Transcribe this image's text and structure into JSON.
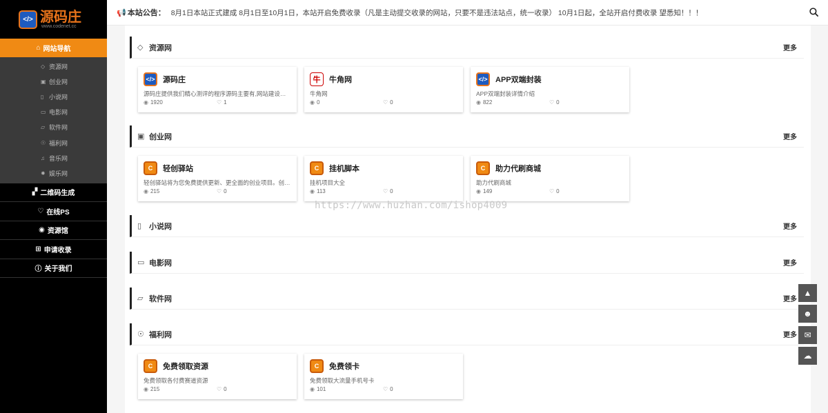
{
  "logo": {
    "mark": "</>",
    "title": "源码庄",
    "subtitle": "www.codenet.cc"
  },
  "sidebar": {
    "active": {
      "icon": "⌂",
      "label": "网站导航"
    },
    "subitems": [
      {
        "icon": "◇",
        "label": "资源网"
      },
      {
        "icon": "▣",
        "label": "创业网"
      },
      {
        "icon": "▯",
        "label": "小说网"
      },
      {
        "icon": "▭",
        "label": "电影网"
      },
      {
        "icon": "▱",
        "label": "软件网"
      },
      {
        "icon": "☉",
        "label": "福利网"
      },
      {
        "icon": "♫",
        "label": "音乐网"
      },
      {
        "icon": "✸",
        "label": "娱乐网"
      }
    ],
    "items": [
      {
        "icon": "▞",
        "label": "二维码生成"
      },
      {
        "icon": "♡",
        "label": "在线PS"
      },
      {
        "icon": "◉",
        "label": "资源馆"
      },
      {
        "icon": "⊞",
        "label": "申请收录"
      },
      {
        "icon": "ⓘ",
        "label": "关于我们"
      }
    ]
  },
  "header": {
    "notice_label": "本站公告：",
    "notice_text": "8月1日本站正式建成 8月1日至10月1日，本站开启免费收录（凡是主动提交收录的网站，只要不是违法站点，统一收录） 10月1日起，全站开启付费收录 望悉知！！！"
  },
  "sections": [
    {
      "icon": "◇",
      "title": "资源网",
      "more": "更多",
      "cards": [
        {
          "logo": "</>",
          "name": "源码庄",
          "desc": "源码庄提供我们精心测评的程序源码主要有,网站建设模板...",
          "views": "1920",
          "likes": "1"
        },
        {
          "logo": "牛",
          "name": "牛角网",
          "desc": "牛角网",
          "views": "0",
          "likes": "0"
        },
        {
          "logo": "</>",
          "name": "APP双端封装",
          "desc": "APP双端封装详情介绍",
          "views": "822",
          "likes": "0"
        }
      ]
    },
    {
      "icon": "▣",
      "title": "创业网",
      "more": "更多",
      "cards": [
        {
          "logo": "C",
          "name": "轻创驿站",
          "desc": "轻创驿站将为您免费提供更新、更全面的创业项目。创业...",
          "views": "215",
          "likes": "0"
        },
        {
          "logo": "C",
          "name": "挂机脚本",
          "desc": "挂机项目大全",
          "views": "113",
          "likes": "0"
        },
        {
          "logo": "C",
          "name": "助力代刷商城",
          "desc": "助力代刷商城",
          "views": "149",
          "likes": "0"
        }
      ]
    },
    {
      "icon": "▯",
      "title": "小说网",
      "more": "更多",
      "cards": []
    },
    {
      "icon": "▭",
      "title": "电影网",
      "more": "更多",
      "cards": []
    },
    {
      "icon": "▱",
      "title": "软件网",
      "more": "更多",
      "cards": []
    },
    {
      "icon": "☉",
      "title": "福利网",
      "more": "更多",
      "cards": [
        {
          "logo": "C",
          "name": "免费领取资源",
          "desc": "免费领取各付费赛道资源",
          "views": "215",
          "likes": "0"
        },
        {
          "logo": "C",
          "name": "免费领卡",
          "desc": "免费领取大流量手机号卡",
          "views": "101",
          "likes": "0"
        }
      ]
    }
  ],
  "float_buttons": [
    {
      "icon": "▲",
      "name": "back-to-top"
    },
    {
      "icon": "☻",
      "name": "qq"
    },
    {
      "icon": "✉",
      "name": "email"
    },
    {
      "icon": "☁",
      "name": "wechat"
    }
  ],
  "watermark": "https://www.huzhan.com/ishop4009"
}
